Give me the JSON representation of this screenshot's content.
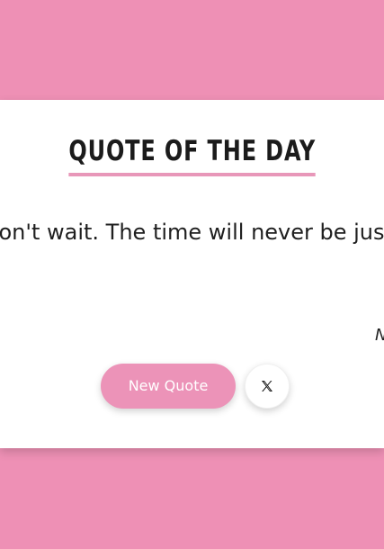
{
  "card": {
    "title": "QUOTE OF THE DAY",
    "quote": "Don't wait. The time will never be just right.",
    "author": "Napoleon Hill"
  },
  "actions": {
    "new_quote_label": "New Quote",
    "share_icon": "x-icon"
  },
  "colors": {
    "background": "#ee90b5",
    "accent": "#ec93b8",
    "card": "#ffffff",
    "text": "#1f1f1f"
  }
}
